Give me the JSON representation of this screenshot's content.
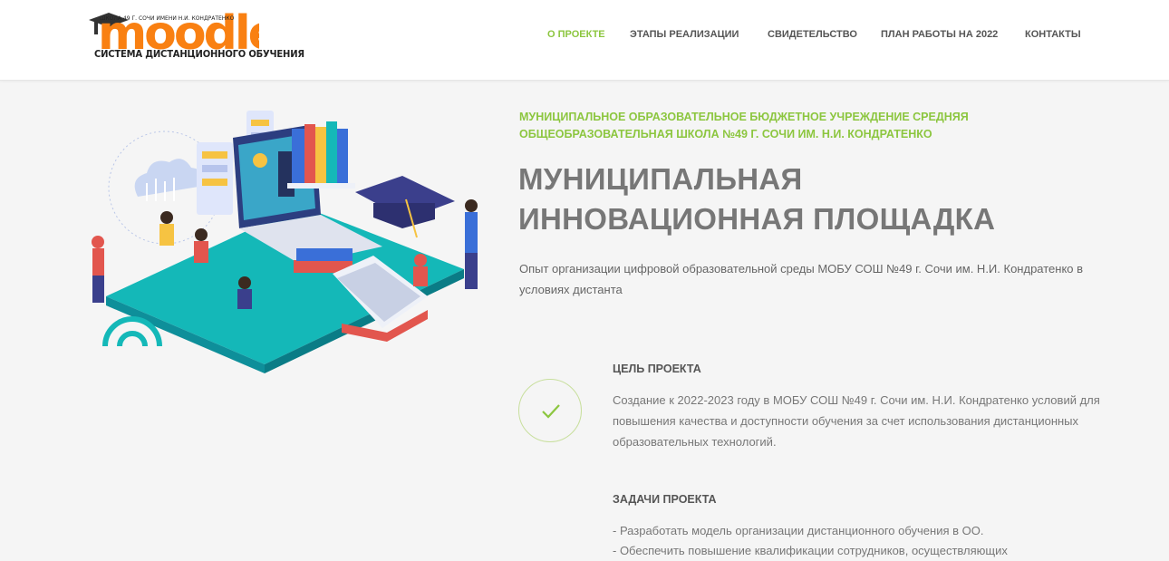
{
  "brand": {
    "logo_word": "moodle",
    "logo_top_text": "ШКОЛА 49 Г. СОЧИ ИМЕНИ Н.И. КОНДРАТЕНКО",
    "logo_subtitle": "СИСТЕМА ДИСТАНЦИОННОГО ОБУЧЕНИЯ",
    "accent_color": "#f98012",
    "green_color": "#8cc63f"
  },
  "nav": {
    "items": [
      {
        "label": "О ПРОЕКТЕ",
        "active": true
      },
      {
        "label": "ЭТАПЫ РЕАЛИЗАЦИИ",
        "active": false
      },
      {
        "label": "СВИДЕТЕЛЬСТВО",
        "active": false
      },
      {
        "label": "ПЛАН РАБОТЫ НА 2022",
        "active": false
      },
      {
        "label": "КОНТАКТЫ",
        "active": false
      }
    ]
  },
  "hero": {
    "kicker": "МУНИЦИПАЛЬНОЕ ОБРАЗОВАТЕЛЬНОЕ БЮДЖЕТНОЕ УЧРЕЖДЕНИЕ СРЕДНЯЯ ОБЩЕОБРАЗОВАТЕЛЬНАЯ ШКОЛА №49 Г. СОЧИ ИМ. Н.И. КОНДРАТЕНКО",
    "title_line1": "МУНИЦИПАЛЬНАЯ",
    "title_line2": "ИННОВАЦИОННАЯ ПЛОЩАДКА",
    "description": "Опыт организации цифровой образовательной среды МОБУ СОШ №49 г. Сочи им. Н.И. Кондратенко в условиях дистанта",
    "illustration_icon": "online-education-illustration"
  },
  "goal": {
    "title": "ЦЕЛЬ ПРОЕКТА",
    "text": "Создание к 2022-2023 году в МОБУ СОШ №49 г. Сочи им. Н.И. Кондратенко условий для повышения качества и доступности обучения за счет использования дистанционных образовательных технологий.",
    "icon": "check-icon"
  },
  "tasks": {
    "title": "ЗАДАЧИ ПРОЕКТА",
    "items": [
      "- Разработать модель организации дистанционного обучения в ОО.",
      "- Обеспечить повышение квалификации сотрудников, осуществляющих"
    ]
  }
}
